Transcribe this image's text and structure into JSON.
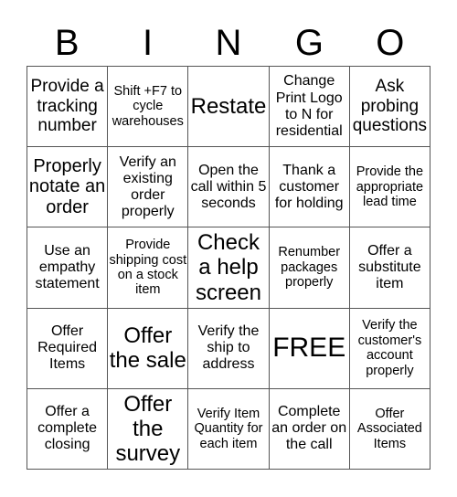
{
  "header": {
    "letters": [
      "B",
      "I",
      "N",
      "G",
      "O"
    ]
  },
  "cells": [
    {
      "text": "Provide a tracking number",
      "size": "s18"
    },
    {
      "text": "Shift +F7 to cycle warehouses",
      "size": "s14"
    },
    {
      "text": "Restate",
      "size": "s24"
    },
    {
      "text": "Change Print Logo to N for residential",
      "size": "s16"
    },
    {
      "text": "Ask probing questions",
      "size": "s18"
    },
    {
      "text": "Properly notate an order",
      "size": "s20"
    },
    {
      "text": "Verify an existing order properly",
      "size": "s16"
    },
    {
      "text": "Open the call within 5 seconds",
      "size": "s16"
    },
    {
      "text": "Thank a customer for holding",
      "size": "s16"
    },
    {
      "text": "Provide the appropriate lead time",
      "size": "s14"
    },
    {
      "text": "Use an empathy statement",
      "size": "s16"
    },
    {
      "text": "Provide shipping cost on a stock item",
      "size": "s14"
    },
    {
      "text": "Check a help screen",
      "size": "s24"
    },
    {
      "text": "Renumber packages properly",
      "size": "s14"
    },
    {
      "text": "Offer a substitute item",
      "size": "s16"
    },
    {
      "text": "Offer Required Items",
      "size": "s16"
    },
    {
      "text": "Offer the sale",
      "size": "s24"
    },
    {
      "text": "Verify the ship to address",
      "size": "s16"
    },
    {
      "text": "FREE",
      "size": "s30"
    },
    {
      "text": "Verify the customer's account properly",
      "size": "s14"
    },
    {
      "text": "Offer a complete closing",
      "size": "s16"
    },
    {
      "text": "Offer the survey",
      "size": "s24"
    },
    {
      "text": "Verify Item Quantity for each item",
      "size": "s14"
    },
    {
      "text": "Complete an order on the call",
      "size": "s16"
    },
    {
      "text": "Offer Associated Items",
      "size": "s14"
    }
  ]
}
